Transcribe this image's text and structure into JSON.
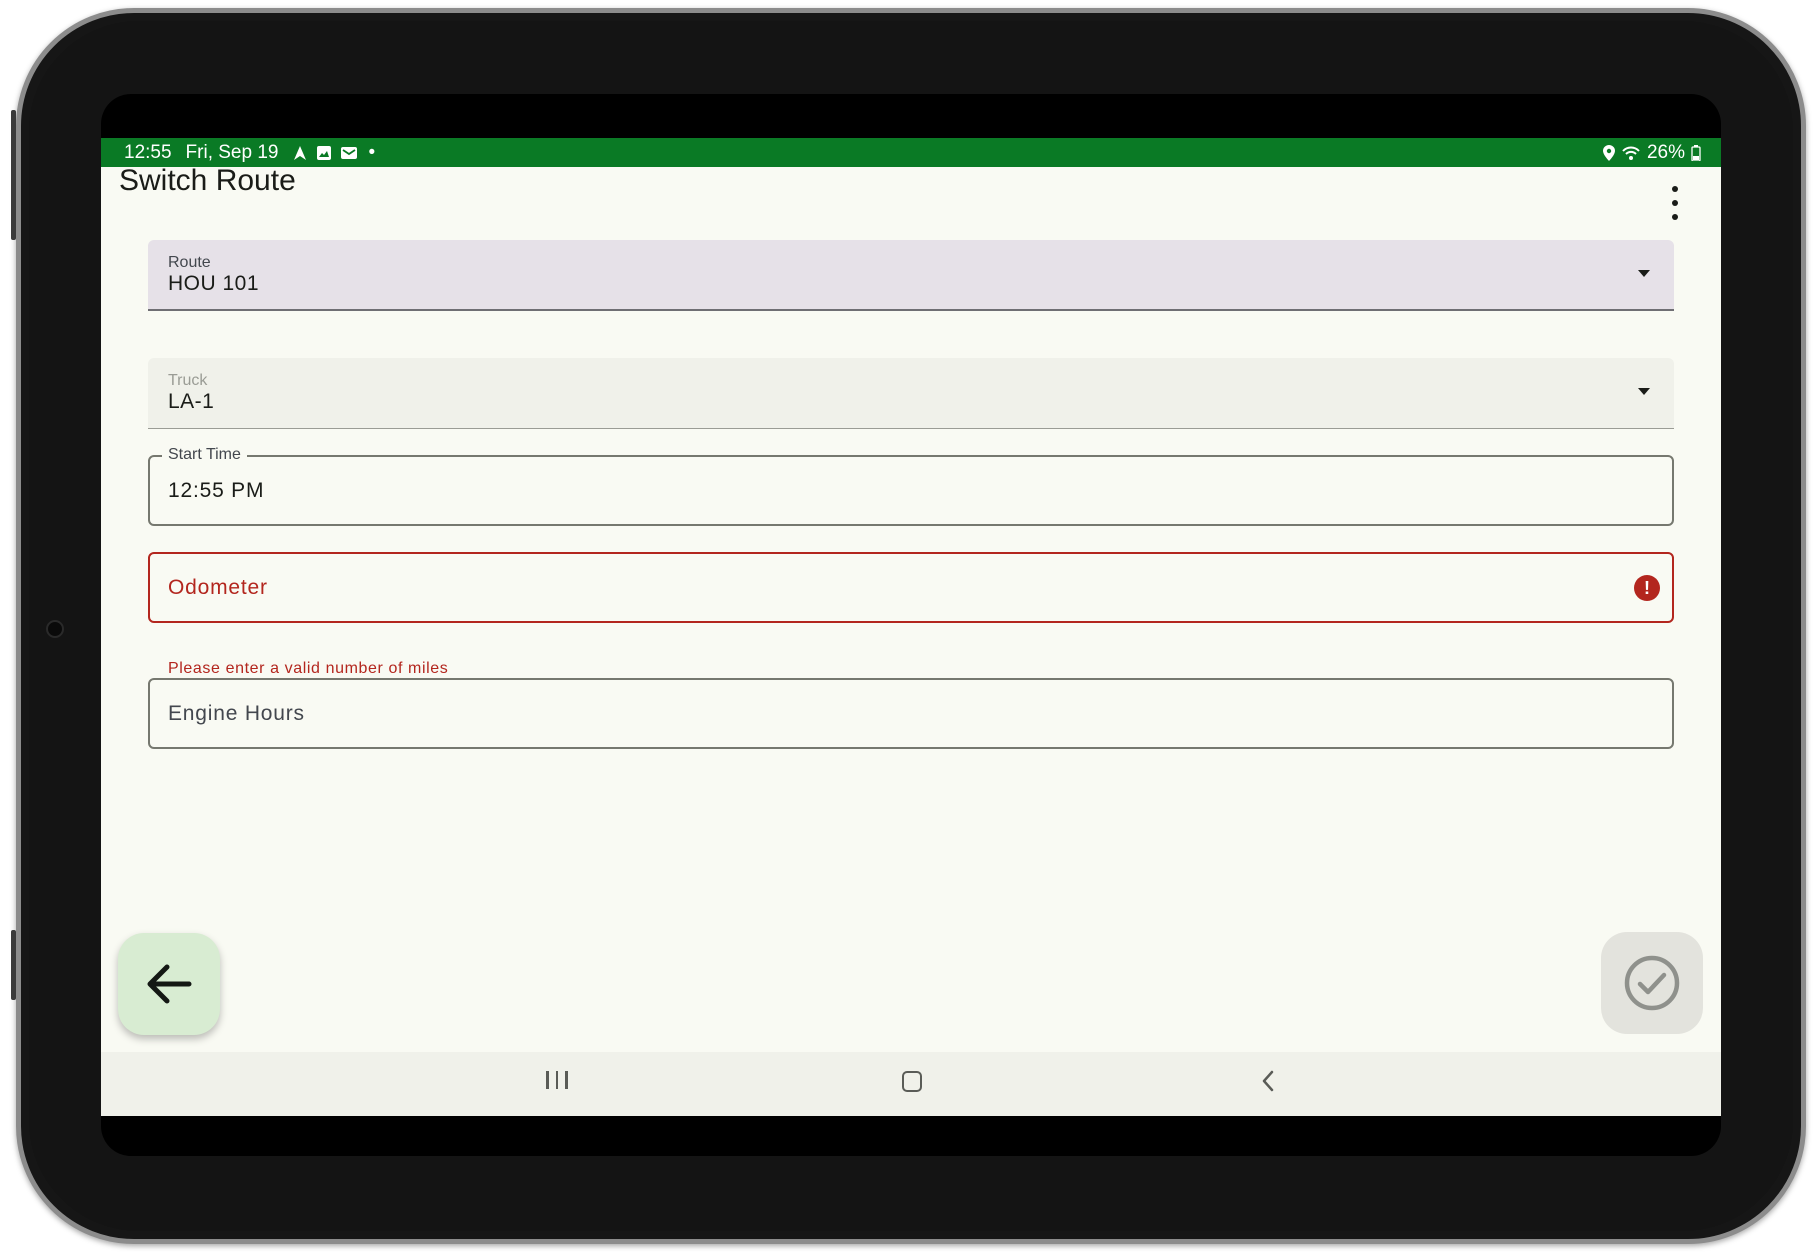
{
  "status_bar": {
    "time": "12:55",
    "date": "Fri, Sep 19",
    "battery": "26%",
    "dot": "•",
    "icons_left": [
      "navigation-icon",
      "image-icon",
      "mail-icon"
    ],
    "icons_right": [
      "location-icon",
      "wifi-icon",
      "battery-icon"
    ]
  },
  "header": {
    "title": "Switch Route",
    "menu_icon": "more-vert-icon"
  },
  "form": {
    "route": {
      "label": "Route",
      "value": "HOU 101"
    },
    "truck": {
      "label": "Truck",
      "value": "LA-1"
    },
    "start_time": {
      "label": "Start Time",
      "value": "12:55 PM"
    },
    "odometer": {
      "placeholder": "Odometer",
      "error": "Please enter a valid number of miles",
      "error_icon": "!"
    },
    "engine_hours": {
      "placeholder": "Engine Hours"
    }
  },
  "actions": {
    "back_icon": "arrow-back-icon",
    "confirm_icon": "check-circle-icon"
  },
  "colors": {
    "status_bar": "#0a7a25",
    "error": "#b3261e",
    "back_fab": "#d8ecd2",
    "route_field": "#e6e1e8"
  }
}
